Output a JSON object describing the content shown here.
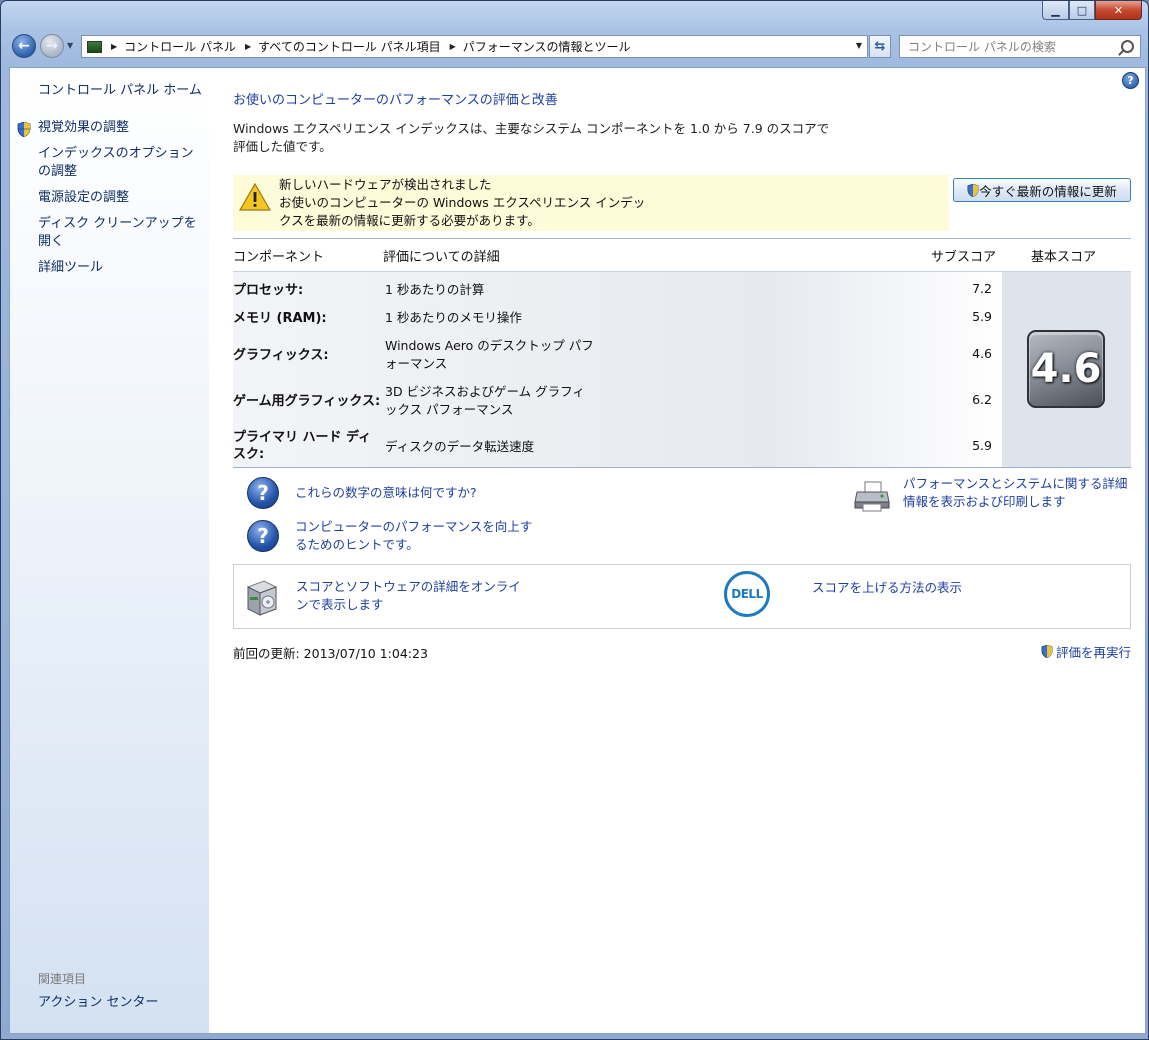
{
  "window": {
    "caption_buttons": {
      "minimize": "▁",
      "maximize": "□",
      "close": "✕"
    }
  },
  "address_bar": {
    "crumbs": [
      "コントロール パネル",
      "すべてのコントロール パネル項目",
      "パフォーマンスの情報とツール"
    ],
    "search_placeholder": "コントロール パネルの検索"
  },
  "sidebar": {
    "home": "コントロール パネル ホーム",
    "items": [
      {
        "label": "視覚効果の調整",
        "icon": "shield-icon"
      },
      {
        "label": "インデックスのオプションの調整"
      },
      {
        "label": "電源設定の調整"
      },
      {
        "label": "ディスク クリーンアップを開く"
      },
      {
        "label": "詳細ツール"
      }
    ],
    "related_heading": "関連項目",
    "related_items": [
      "アクション センター"
    ]
  },
  "main": {
    "title": "お使いのコンピューターのパフォーマンスの評価と改善",
    "description": "Windows エクスペリエンス インデックスは、主要なシステム コンポーネントを 1.0 から 7.9 のスコアで評価した値です。",
    "warning": {
      "line1": "新しいハードウェアが検出されました",
      "line2": "お使いのコンピューターの Windows エクスペリエンス インデッ",
      "line3": "クスを最新の情報に更新する必要があります。"
    },
    "update_button": "今すぐ最新の情報に更新",
    "table": {
      "headers": {
        "component": "コンポーネント",
        "detail": "評価についての詳細",
        "subscore": "サブスコア",
        "base": "基本スコア"
      },
      "rows": [
        {
          "component": "プロセッサ:",
          "detail": "1 秒あたりの計算",
          "subscore": "7.2"
        },
        {
          "component": "メモリ (RAM):",
          "detail": "1 秒あたりのメモリ操作",
          "subscore": "5.9"
        },
        {
          "component": "グラフィックス:",
          "detail": "Windows Aero のデスクトップ パフォーマンス",
          "subscore": "4.6"
        },
        {
          "component": "ゲーム用グラフィックス:",
          "detail": "3D ビジネスおよびゲーム グラフィックス パフォーマンス",
          "subscore": "6.2"
        },
        {
          "component": "プライマリ ハード ディスク:",
          "detail": "ディスクのデータ転送速度",
          "subscore": "5.9"
        }
      ],
      "base_score": "4.6"
    },
    "help_links": [
      "これらの数字の意味は何ですか?",
      "コンピューターのパフォーマンスを向上するためのヒントです。"
    ],
    "print_link": "パフォーマンスとシステムに関する詳細情報を表示および印刷します",
    "online_link": "スコアとソフトウェアの詳細をオンラインで表示します",
    "dell_logo_text": "DELL",
    "dell_link": "スコアを上げる方法の表示",
    "last_update": "前回の更新: 2013/07/10 1:04:23",
    "rerun_link": "評価を再実行"
  }
}
